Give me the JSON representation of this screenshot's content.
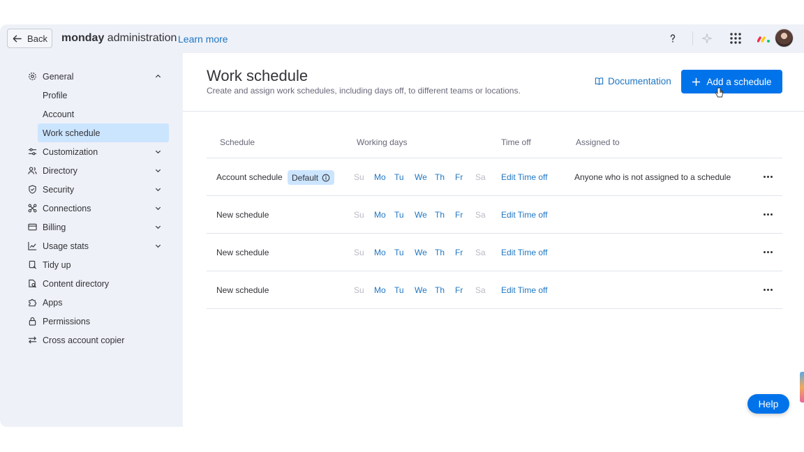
{
  "topbar": {
    "back_label": "Back",
    "brand_bold": "monday",
    "brand_rest": " administration",
    "learn_more": "Learn more",
    "help_icon": "question-icon",
    "sparkle_icon": "sparkle-icon",
    "apps_icon": "grid-icon"
  },
  "sidebar": {
    "general": "General",
    "general_items": [
      "Profile",
      "Account",
      "Work schedule"
    ],
    "items": [
      "Customization",
      "Directory",
      "Security",
      "Connections",
      "Billing",
      "Usage stats",
      "Tidy up",
      "Content directory",
      "Apps",
      "Permissions",
      "Cross account copier"
    ]
  },
  "main": {
    "title": "Work schedule",
    "subtitle": "Create and assign work schedules, including days off, to different teams or locations.",
    "documentation": "Documentation",
    "add_button": "Add a schedule"
  },
  "table": {
    "headers": [
      "Schedule",
      "Working days",
      "Time off",
      "Assigned to"
    ],
    "days": [
      "Su",
      "Mo",
      "Tu",
      "We",
      "Th",
      "Fr",
      "Sa"
    ],
    "rows": [
      {
        "name": "Account schedule",
        "badge": "Default",
        "time_off": "Edit Time off",
        "assigned": "Anyone who is not assigned to a schedule"
      },
      {
        "name": "New schedule",
        "time_off": "Edit Time off",
        "assigned": ""
      },
      {
        "name": "New schedule",
        "time_off": "Edit Time off",
        "assigned": ""
      },
      {
        "name": "New schedule",
        "time_off": "Edit Time off",
        "assigned": ""
      }
    ]
  },
  "help_label": "Help",
  "colors": {
    "accent": "#0073ea",
    "link": "#1f76c2",
    "active_bg": "#cce5ff"
  }
}
